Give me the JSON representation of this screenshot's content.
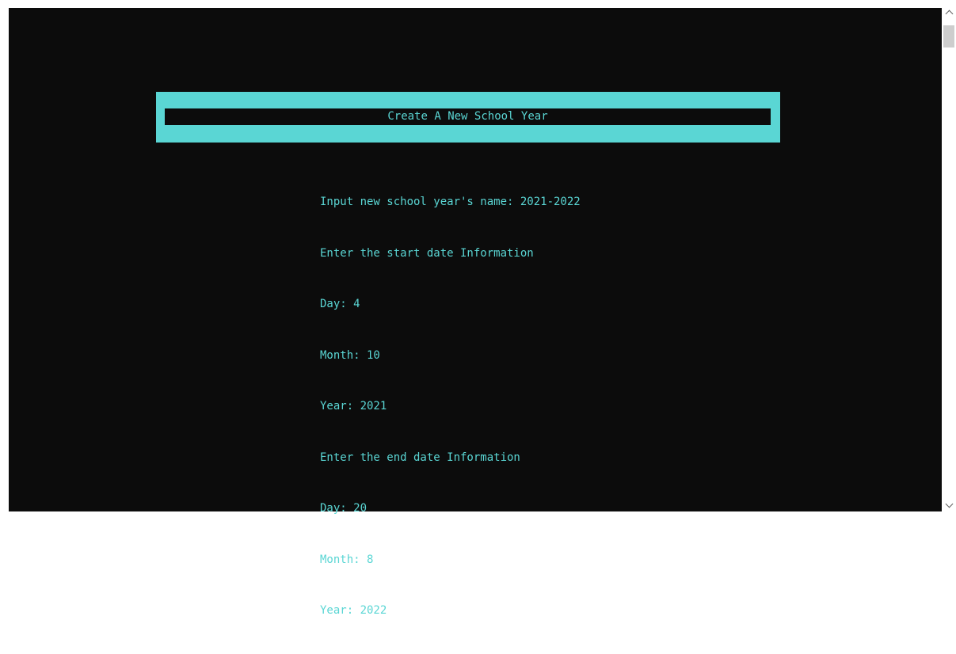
{
  "banner": {
    "title": "Create A New School Year"
  },
  "console": {
    "lines": [
      "Input new school year's name: 2021-2022",
      "Enter the start date Information",
      "Day: 4",
      "Month: 10",
      "Year: 2021",
      "Enter the end date Information",
      "Day: 20",
      "Month: 8",
      "Year: 2022"
    ]
  },
  "colors": {
    "background": "#0c0c0c",
    "accent": "#5ad6d4"
  },
  "scrollbar": {
    "up_icon": "chevron-up-icon",
    "down_icon": "chevron-down-icon"
  }
}
